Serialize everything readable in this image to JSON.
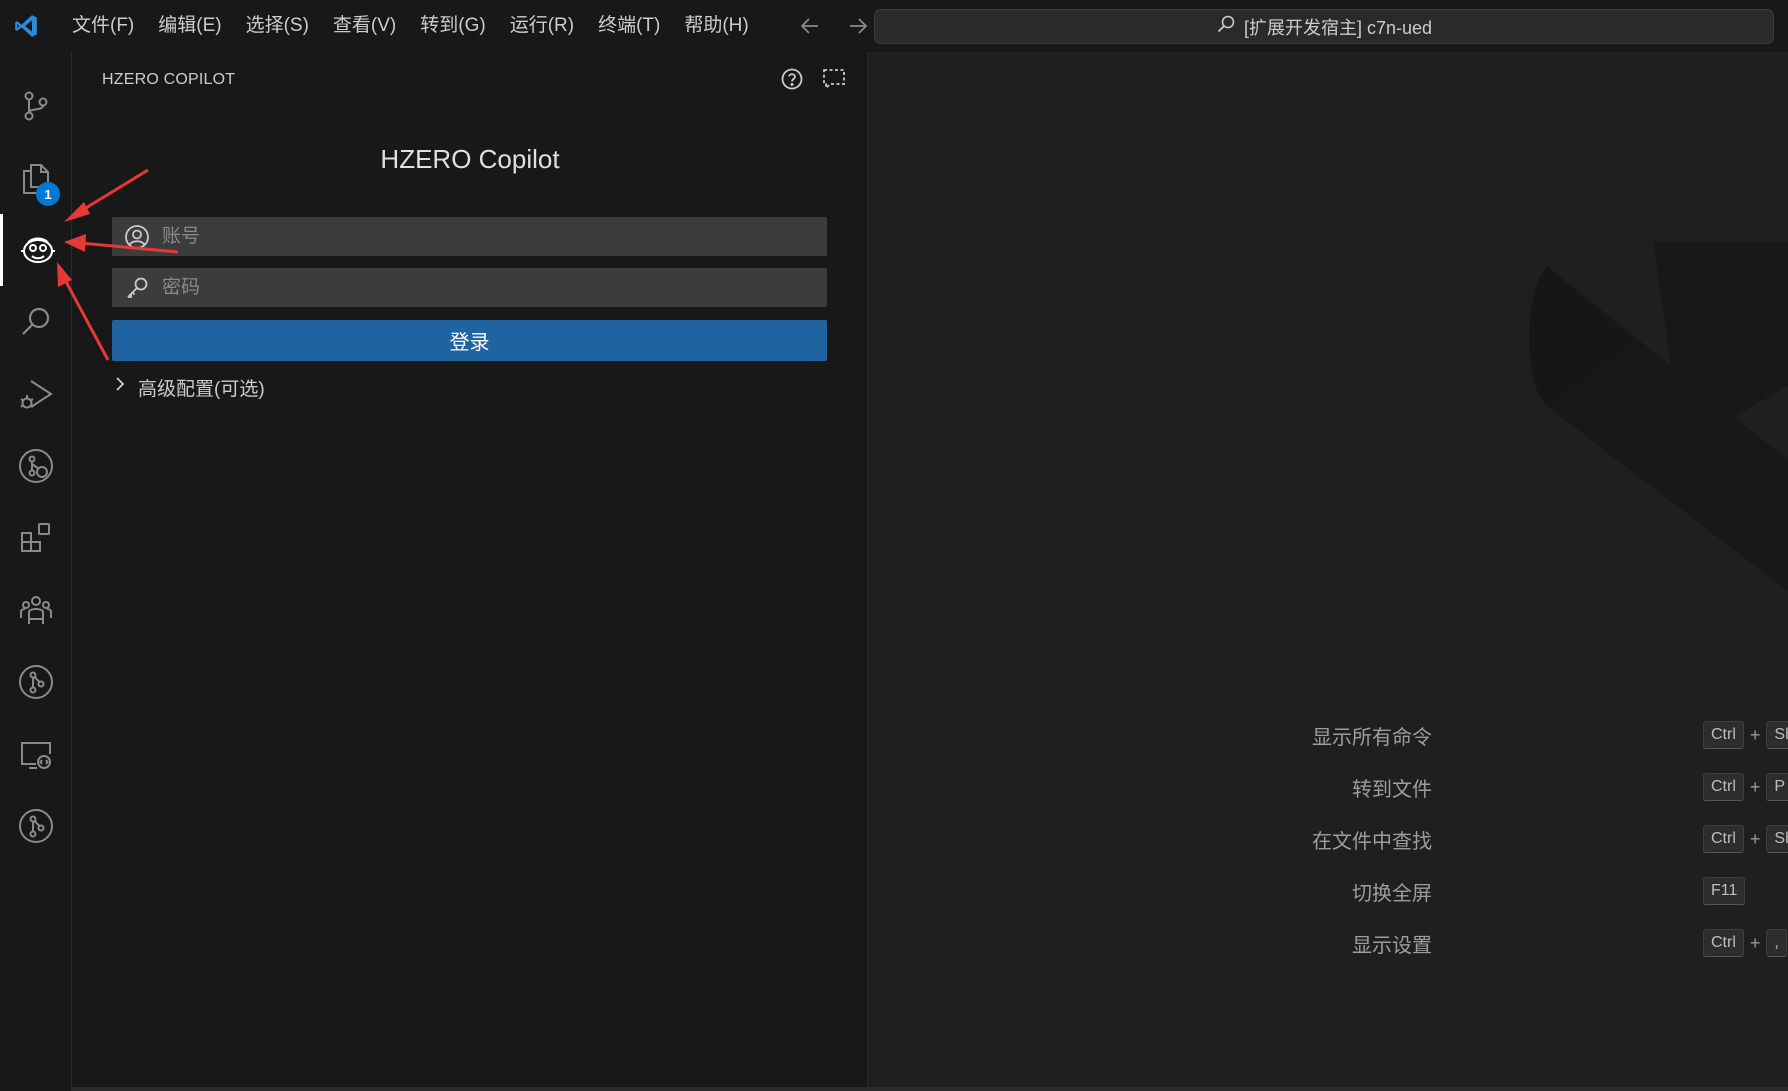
{
  "titlebar": {
    "menus": [
      "文件(F)",
      "编辑(E)",
      "选择(S)",
      "查看(V)",
      "转到(G)",
      "运行(R)",
      "终端(T)",
      "帮助(H)"
    ],
    "command_center": "[扩展开发宿主] c7n-ued"
  },
  "activitybar": {
    "items": [
      {
        "name": "source-control-icon"
      },
      {
        "name": "explorer-icon",
        "badge": "1"
      },
      {
        "name": "hzero-copilot-icon",
        "active": true
      },
      {
        "name": "search-icon"
      },
      {
        "name": "run-debug-icon"
      },
      {
        "name": "git-graph-icon"
      },
      {
        "name": "extensions-icon"
      },
      {
        "name": "team-icon"
      },
      {
        "name": "git-icon"
      },
      {
        "name": "remote-explorer-icon"
      },
      {
        "name": "git-lens-icon"
      }
    ]
  },
  "sidebar": {
    "title": "HZERO COPILOT",
    "heading": "HZERO Copilot",
    "account_placeholder": "账号",
    "password_placeholder": "密码",
    "login_label": "登录",
    "advanced_label": "高级配置(可选)"
  },
  "editor": {
    "shortcuts": [
      {
        "label": "显示所有命令",
        "keys": [
          "Ctrl",
          "+",
          "Sh"
        ]
      },
      {
        "label": "转到文件",
        "keys": [
          "Ctrl",
          "+",
          "P"
        ]
      },
      {
        "label": "在文件中查找",
        "keys": [
          "Ctrl",
          "+",
          "Sh"
        ]
      },
      {
        "label": "切换全屏",
        "keys": [
          "F11"
        ]
      },
      {
        "label": "显示设置",
        "keys": [
          "Ctrl",
          "+",
          ","
        ]
      }
    ]
  },
  "colors": {
    "accent": "#0078d4",
    "login_button": "#1f63a0",
    "annotation_arrow": "#e53935"
  }
}
